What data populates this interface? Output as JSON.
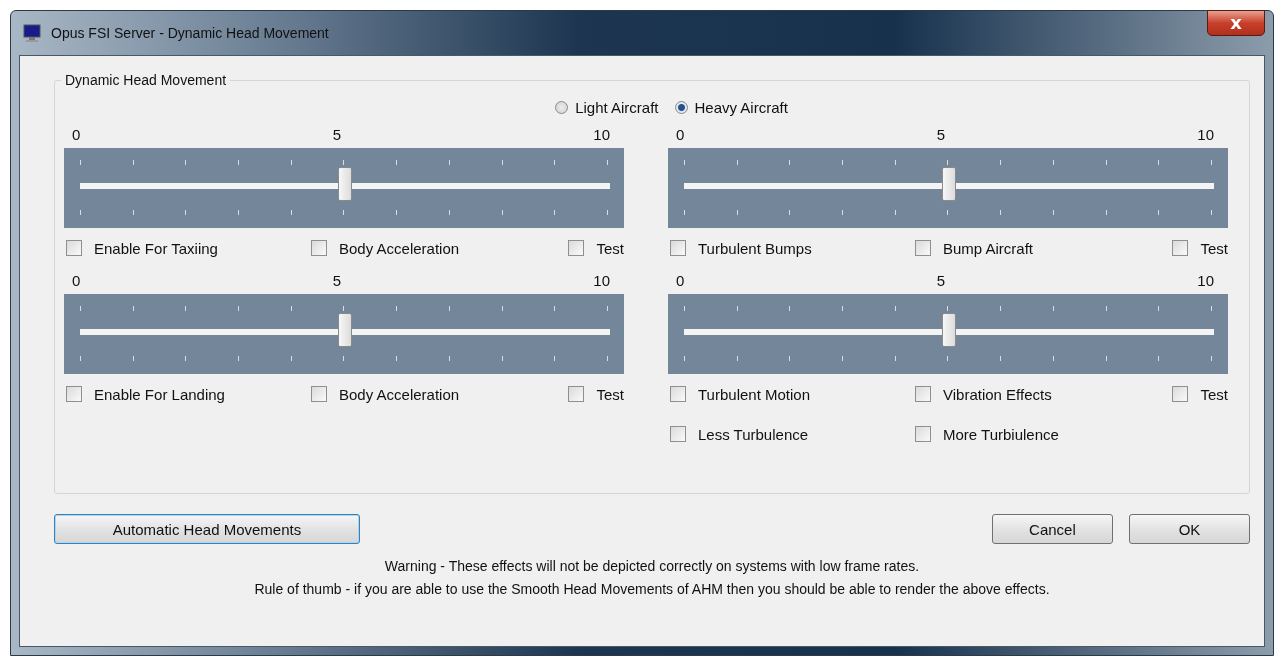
{
  "window": {
    "title": "Opus FSI Server - Dynamic Head Movement",
    "close": "x"
  },
  "group": {
    "title": "Dynamic Head Movement"
  },
  "aircraft": [
    {
      "label": "Light Aircraft",
      "selected": false
    },
    {
      "label": "Heavy Aircraft",
      "selected": true
    }
  ],
  "sliders": [
    {
      "scale": [
        "0",
        "5",
        "10"
      ],
      "level": 0.5,
      "checkbox_rows": [
        [
          {
            "label": "Enable For Taxiing",
            "checked": false
          },
          {
            "label": "Body Acceleration",
            "checked": false
          },
          {
            "label": "Test",
            "checked": false
          }
        ]
      ]
    },
    {
      "scale": [
        "0",
        "5",
        "10"
      ],
      "level": 0.5,
      "checkbox_rows": [
        [
          {
            "label": "Turbulent Bumps",
            "checked": false
          },
          {
            "label": "Bump Aircraft",
            "checked": false
          },
          {
            "label": "Test",
            "checked": false
          }
        ]
      ]
    },
    {
      "scale": [
        "0",
        "5",
        "10"
      ],
      "level": 0.5,
      "checkbox_rows": [
        [
          {
            "label": "Enable For Landing",
            "checked": false
          },
          {
            "label": "Body Acceleration",
            "checked": false
          },
          {
            "label": "Test",
            "checked": false
          }
        ]
      ]
    },
    {
      "scale": [
        "0",
        "5",
        "10"
      ],
      "level": 0.5,
      "checkbox_rows": [
        [
          {
            "label": "Turbulent Motion",
            "checked": false
          },
          {
            "label": "Vibration Effects",
            "checked": false
          },
          {
            "label": "Test",
            "checked": false
          }
        ],
        [
          {
            "label": "Less Turbulence",
            "checked": false
          },
          {
            "label": "More Turbiulence",
            "checked": false
          }
        ]
      ]
    }
  ],
  "buttons": {
    "automatic": "Automatic Head Movements",
    "cancel": "Cancel",
    "ok": "OK"
  },
  "notes": [
    "Warning - These effects will not be depicted correctly on systems with low frame rates.",
    "Rule of thumb - if you are able to use the Smooth Head Movements of AHM then you should be able to render the above effects."
  ]
}
